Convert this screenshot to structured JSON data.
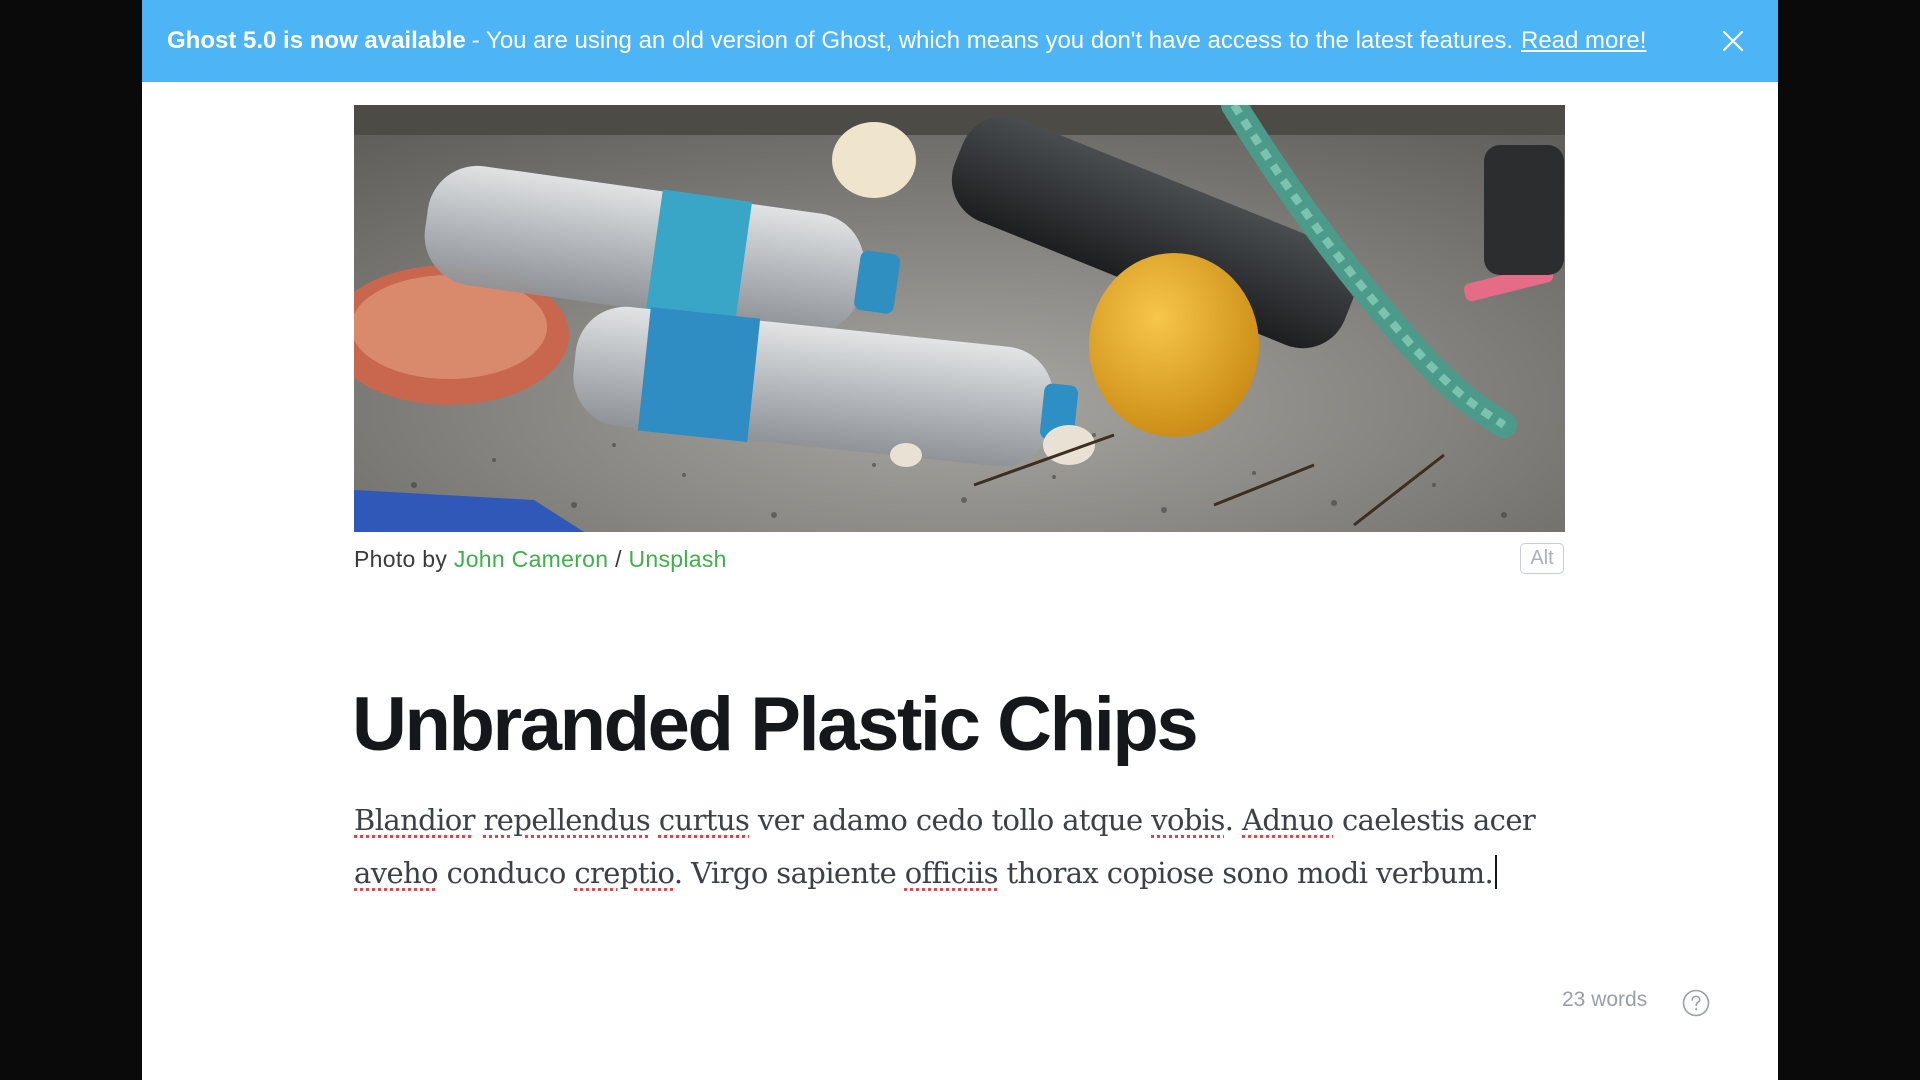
{
  "banner": {
    "title": "Ghost 5.0 is now available",
    "message": "- You are using an old version of Ghost, which means you don't have access to the latest features.",
    "link_label": "Read more!",
    "close_icon": "close-icon",
    "background": "#4db5f5"
  },
  "feature_image": {
    "alt_button": "Alt",
    "caption": {
      "prefix": "Photo by",
      "author": "John Cameron",
      "separator": "/",
      "source": "Unsplash"
    }
  },
  "post": {
    "title": "Unbranded Plastic Chips",
    "body_line1": [
      {
        "text": "Blandior",
        "spell": true
      },
      {
        "text": " ",
        "spell": false
      },
      {
        "text": "repellendus",
        "spell": true
      },
      {
        "text": " ",
        "spell": false
      },
      {
        "text": "curtus",
        "spell": true
      },
      {
        "text": " ver adamo cedo tollo atque ",
        "spell": false
      },
      {
        "text": "vobis",
        "spell": true
      },
      {
        "text": ". ",
        "spell": false
      },
      {
        "text": "Adnuo",
        "spell": true
      },
      {
        "text": " caelestis acer",
        "spell": false
      }
    ],
    "body_line2": [
      {
        "text": "aveho",
        "spell": true
      },
      {
        "text": " conduco ",
        "spell": false
      },
      {
        "text": "creptio",
        "spell": true
      },
      {
        "text": ". Virgo sapiente ",
        "spell": false
      },
      {
        "text": "officiis",
        "spell": true
      },
      {
        "text": " thorax copiose sono modi verbum.",
        "spell": false
      }
    ]
  },
  "footer": {
    "word_count": "23 words",
    "help_icon": "help-circle-icon"
  },
  "colors": {
    "accent_green": "#3eb04b",
    "title": "#15171a",
    "spellcheck": "#e0454b"
  }
}
